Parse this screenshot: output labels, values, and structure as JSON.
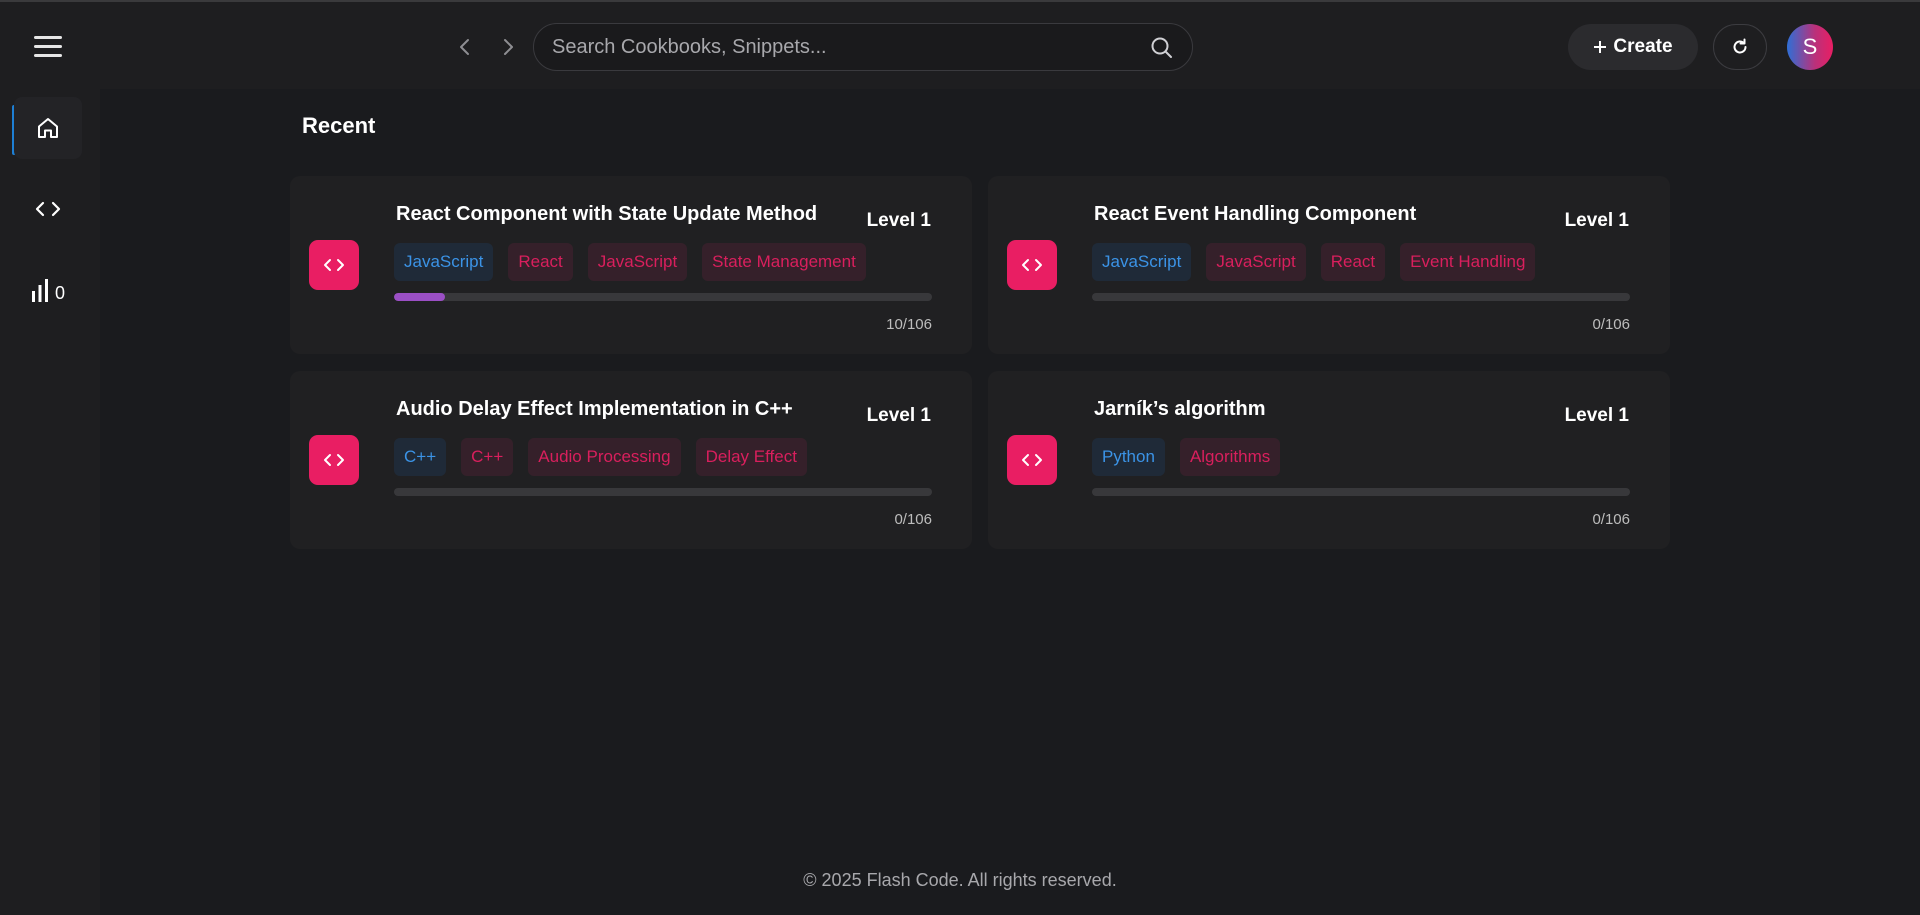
{
  "header": {
    "search_placeholder": "Search Cookbooks, Snippets...",
    "create_label": "Create"
  },
  "user": {
    "initial": "S"
  },
  "sidebar": {
    "stats_count": "0"
  },
  "main": {
    "section_title": "Recent",
    "cards": [
      {
        "title": "React Component with State Update Method",
        "level": "Level 1",
        "tags": [
          {
            "label": "JavaScript",
            "kind": "language"
          },
          {
            "label": "React",
            "kind": "topic"
          },
          {
            "label": "JavaScript",
            "kind": "topic"
          },
          {
            "label": "State Management",
            "kind": "topic"
          }
        ],
        "progress_fraction": 0.094,
        "count": "10/106"
      },
      {
        "title": "React Event Handling Component",
        "level": "Level 1",
        "tags": [
          {
            "label": "JavaScript",
            "kind": "language"
          },
          {
            "label": "JavaScript",
            "kind": "topic"
          },
          {
            "label": "React",
            "kind": "topic"
          },
          {
            "label": "Event Handling",
            "kind": "topic"
          }
        ],
        "progress_fraction": 0,
        "count": "0/106"
      },
      {
        "title": "Audio Delay Effect Implementation in C++",
        "level": "Level 1",
        "tags": [
          {
            "label": "C++",
            "kind": "language"
          },
          {
            "label": "C++",
            "kind": "topic"
          },
          {
            "label": "Audio Processing",
            "kind": "topic"
          },
          {
            "label": "Delay Effect",
            "kind": "topic"
          }
        ],
        "progress_fraction": 0,
        "count": "0/106"
      },
      {
        "title": "Jarník’s algorithm",
        "level": "Level 1",
        "tags": [
          {
            "label": "Python",
            "kind": "language"
          },
          {
            "label": "Algorithms",
            "kind": "topic"
          }
        ],
        "progress_fraction": 0,
        "count": "0/106"
      }
    ]
  },
  "footer": {
    "text": "© 2025 Flash Code. All rights reserved."
  },
  "colors": {
    "accent": "#e91e63",
    "language_tag_text": "#3b93e6",
    "topic_tag_text": "#d91f5d",
    "progress_fill": "#9b4fc5",
    "active_indicator": "#1e7fd4"
  },
  "icons": [
    "menu-icon",
    "back-arrow-icon",
    "forward-arrow-icon",
    "search-icon",
    "plus-icon",
    "refresh-icon",
    "home-icon",
    "code-icon",
    "bar-chart-icon"
  ]
}
